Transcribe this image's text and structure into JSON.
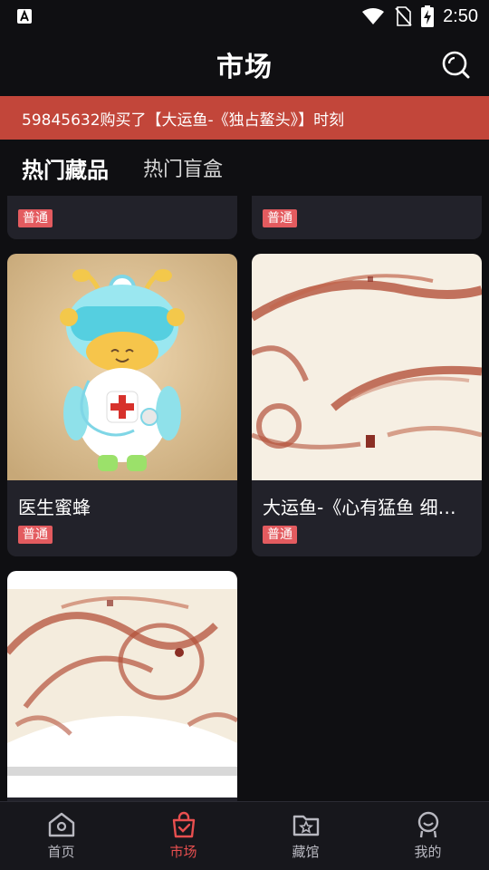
{
  "status_bar": {
    "time": "2:50"
  },
  "header": {
    "title": "市场"
  },
  "ticker": {
    "text": "59845632购买了【大运鱼-《独占鳌头》】时刻"
  },
  "tabs": [
    {
      "label": "热门藏品",
      "active": true
    },
    {
      "label": "热门盲盒",
      "active": false
    }
  ],
  "cards": [
    {
      "title": "",
      "badge": "普通"
    },
    {
      "title": "",
      "badge": "普通"
    },
    {
      "title": "医生蜜蜂",
      "badge": "普通"
    },
    {
      "title": "大运鱼-《心有猛鱼 细…",
      "badge": "普通"
    },
    {
      "title": "",
      "badge": ""
    }
  ],
  "bottom_nav": [
    {
      "label": "首页",
      "icon": "home-icon",
      "active": false
    },
    {
      "label": "市场",
      "icon": "shopping-bag-icon",
      "active": true
    },
    {
      "label": "藏馆",
      "icon": "folder-star-icon",
      "active": false
    },
    {
      "label": "我的",
      "icon": "profile-icon",
      "active": false
    }
  ],
  "colors": {
    "accent": "#c2463a",
    "badge": "#e35b5f",
    "card_bg": "#22222a",
    "page_bg": "#0f0f12",
    "nav_active": "#e84f4f"
  }
}
